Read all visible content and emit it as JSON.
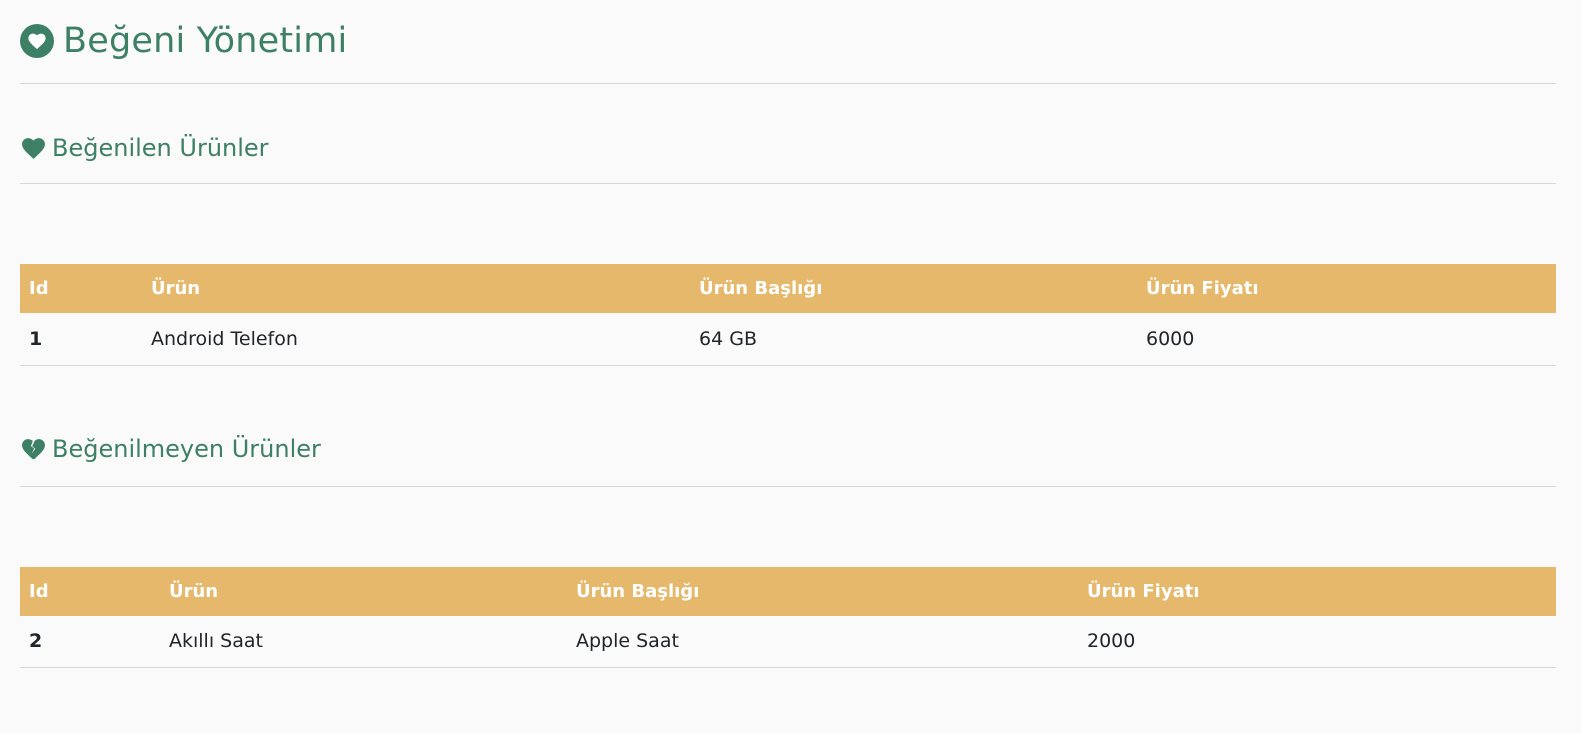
{
  "page": {
    "title": "Beğeni Yönetimi",
    "icon": "heart-circle-icon",
    "accent_color": "#3d8066",
    "table_header_color": "#e5b86b"
  },
  "liked": {
    "title": "Beğenilen Ürünler",
    "icon": "heart-icon",
    "columns": [
      "Id",
      "Ürün",
      "Ürün Başlığı",
      "Ürün Fiyatı"
    ],
    "rows": [
      {
        "id": "1",
        "product": "Android Telefon",
        "heading": "64 GB",
        "price": "6000"
      }
    ]
  },
  "disliked": {
    "title": "Beğenilmeyen Ürünler",
    "icon": "heart-broken-icon",
    "columns": [
      "Id",
      "Ürün",
      "Ürün Başlığı",
      "Ürün Fiyatı"
    ],
    "rows": [
      {
        "id": "2",
        "product": "Akıllı Saat",
        "heading": "Apple Saat",
        "price": "2000"
      }
    ]
  }
}
